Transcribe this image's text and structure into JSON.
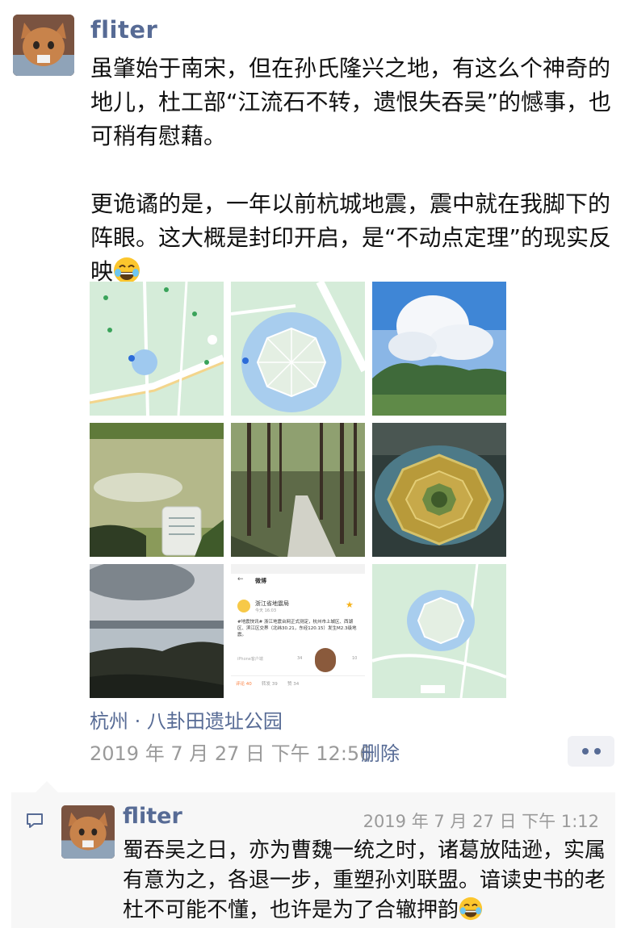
{
  "post": {
    "author": "fliter",
    "paragraph_1": "虽肇始于南宋，但在孙氏隆兴之地，有这么个神奇的地儿，杜工部“江流石不转，遗恨失吞吴”的憾事，也可稍有慰藉。",
    "paragraph_2": "更诡谲的是，一年以前杭城地震，震中就在我脚下的阵眼。这大概是封印开启，是“不动点定理”的现实反映",
    "emoji": "grin-sweat-emoji",
    "location": "杭州 · 八卦田遗址公园",
    "timestamp": "2019 年 7 月 27 日  下午 12:56",
    "delete_label": "删除"
  },
  "photos": [
    {
      "name": "map-screenshot-1"
    },
    {
      "name": "map-screenshot-2"
    },
    {
      "name": "photo-cloud-mountain"
    },
    {
      "name": "photo-pond-sign"
    },
    {
      "name": "photo-forest-path"
    },
    {
      "name": "photo-bagua-aerial"
    },
    {
      "name": "photo-city-lake"
    },
    {
      "name": "weibo-screenshot"
    },
    {
      "name": "map-screenshot-3"
    }
  ],
  "weibo": {
    "header": "微博",
    "account": "浙江省地震局",
    "time": "今天 16:03",
    "body": "#地震快讯# 浙江地震台网正式测定，杭州市上城区、西湖区、滨江区交界（北纬30.21，东经120.15）发生M2.3级地震。",
    "source": "iPhone客户端",
    "likes": "34",
    "reposts": "10",
    "tabs": [
      "评论 40",
      "转发 39",
      "赞 34"
    ]
  },
  "comment": {
    "author": "fliter",
    "timestamp": "2019 年 7 月 27 日  下午 1:12",
    "text": "蜀吞吴之日，亦为曹魏一统之时，诸葛放陆逊，实属有意为之，各退一步，重塑孙刘联盟。谙读史书的老杜不可能不懂，也许是为了合辙押韵"
  },
  "colors": {
    "link": "#576b95",
    "meta": "#9a9a9a",
    "text": "#111111",
    "comment_bg": "#f7f7f7"
  }
}
